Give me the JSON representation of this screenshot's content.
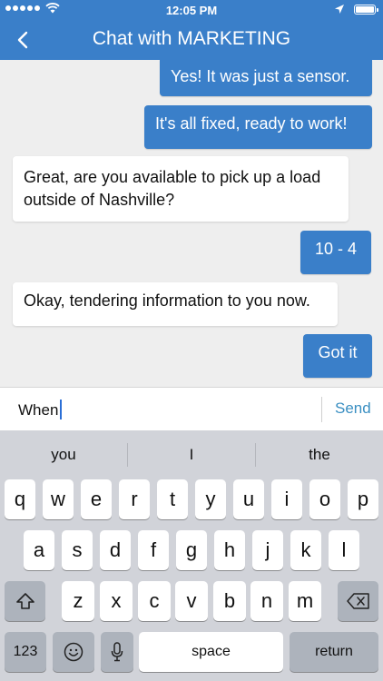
{
  "status_bar": {
    "time": "12:05 PM"
  },
  "header": {
    "title": "Chat with MARKETING"
  },
  "messages": [
    {
      "direction": "out",
      "text": "Yes! It was just a sensor."
    },
    {
      "direction": "out",
      "text": "It's all fixed, ready to work!"
    },
    {
      "direction": "in",
      "line1": "Great, are you available to pick up a load",
      "line2": "outside of Nashville?"
    },
    {
      "direction": "out",
      "text": "10 - 4"
    },
    {
      "direction": "in",
      "text": "Okay, tendering information to you now."
    },
    {
      "direction": "out",
      "text": "Got it"
    }
  ],
  "compose": {
    "value": "When",
    "send_label": "Send"
  },
  "keyboard": {
    "suggestions": [
      "you",
      "I",
      "the"
    ],
    "row1": [
      "q",
      "w",
      "e",
      "r",
      "t",
      "y",
      "u",
      "i",
      "o",
      "p"
    ],
    "row2": [
      "a",
      "s",
      "d",
      "f",
      "g",
      "h",
      "j",
      "k",
      "l"
    ],
    "row3": [
      "z",
      "x",
      "c",
      "v",
      "b",
      "n",
      "m"
    ],
    "numbers_label": "123",
    "space_label": "space",
    "return_label": "return"
  },
  "colors": {
    "accent": "#3a7fc9",
    "background": "#eeeeee",
    "keyboard": "#d1d3d9",
    "send": "#3a8fc2"
  }
}
